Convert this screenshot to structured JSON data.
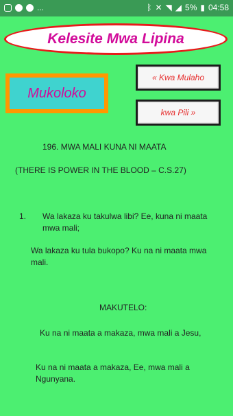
{
  "status_bar": {
    "left_overflow": "...",
    "battery": "5%",
    "time": "04:58"
  },
  "header": {
    "title": "Kelesite Mwa Lipina"
  },
  "buttons": {
    "home": "Mukoloko",
    "prev": "« Kwa Mulaho",
    "next": "kwa Pili »"
  },
  "hymn": {
    "title": "196. MWA MALI KUNA NI MAATA",
    "subtitle": "(THERE IS POWER IN THE BLOOD – C.S.27)",
    "verse_number": "1.",
    "verse_line1": "Wa lakaza ku takulwa libi? Ee, kuna ni maata mwa mali;",
    "verse_line2": "Wa lakaza ku tula bukopo? Ku na ni maata mwa mali.",
    "chorus_label": "MAKUTELO:",
    "chorus_line1": "Ku na ni maata a makaza, mwa mali a Jesu,",
    "chorus_line2": "Ku na ni maata a makaza, Ee, mwa mali a Ngunyana."
  }
}
